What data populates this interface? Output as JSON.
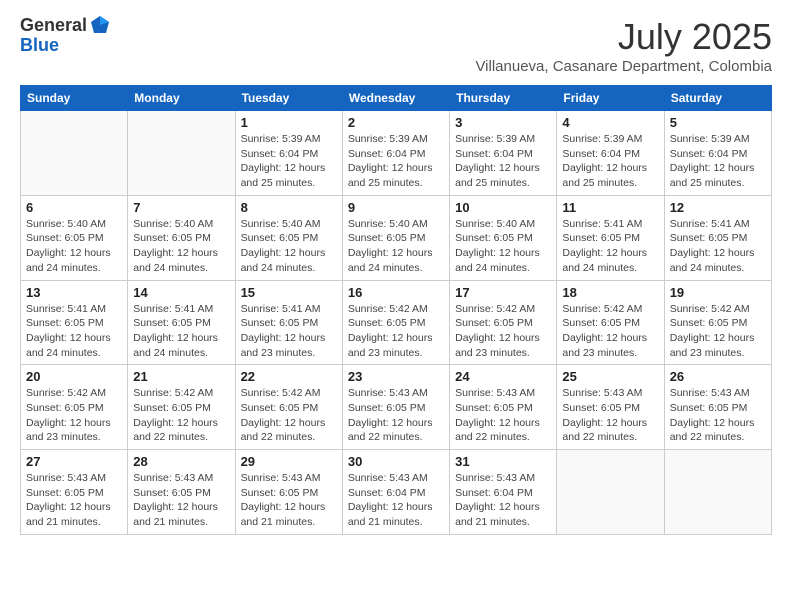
{
  "logo": {
    "general": "General",
    "blue": "Blue"
  },
  "header": {
    "month": "July 2025",
    "location": "Villanueva, Casanare Department, Colombia"
  },
  "weekdays": [
    "Sunday",
    "Monday",
    "Tuesday",
    "Wednesday",
    "Thursday",
    "Friday",
    "Saturday"
  ],
  "weeks": [
    [
      {
        "day": "",
        "detail": ""
      },
      {
        "day": "",
        "detail": ""
      },
      {
        "day": "1",
        "detail": "Sunrise: 5:39 AM\nSunset: 6:04 PM\nDaylight: 12 hours and 25 minutes."
      },
      {
        "day": "2",
        "detail": "Sunrise: 5:39 AM\nSunset: 6:04 PM\nDaylight: 12 hours and 25 minutes."
      },
      {
        "day": "3",
        "detail": "Sunrise: 5:39 AM\nSunset: 6:04 PM\nDaylight: 12 hours and 25 minutes."
      },
      {
        "day": "4",
        "detail": "Sunrise: 5:39 AM\nSunset: 6:04 PM\nDaylight: 12 hours and 25 minutes."
      },
      {
        "day": "5",
        "detail": "Sunrise: 5:39 AM\nSunset: 6:04 PM\nDaylight: 12 hours and 25 minutes."
      }
    ],
    [
      {
        "day": "6",
        "detail": "Sunrise: 5:40 AM\nSunset: 6:05 PM\nDaylight: 12 hours and 24 minutes."
      },
      {
        "day": "7",
        "detail": "Sunrise: 5:40 AM\nSunset: 6:05 PM\nDaylight: 12 hours and 24 minutes."
      },
      {
        "day": "8",
        "detail": "Sunrise: 5:40 AM\nSunset: 6:05 PM\nDaylight: 12 hours and 24 minutes."
      },
      {
        "day": "9",
        "detail": "Sunrise: 5:40 AM\nSunset: 6:05 PM\nDaylight: 12 hours and 24 minutes."
      },
      {
        "day": "10",
        "detail": "Sunrise: 5:40 AM\nSunset: 6:05 PM\nDaylight: 12 hours and 24 minutes."
      },
      {
        "day": "11",
        "detail": "Sunrise: 5:41 AM\nSunset: 6:05 PM\nDaylight: 12 hours and 24 minutes."
      },
      {
        "day": "12",
        "detail": "Sunrise: 5:41 AM\nSunset: 6:05 PM\nDaylight: 12 hours and 24 minutes."
      }
    ],
    [
      {
        "day": "13",
        "detail": "Sunrise: 5:41 AM\nSunset: 6:05 PM\nDaylight: 12 hours and 24 minutes."
      },
      {
        "day": "14",
        "detail": "Sunrise: 5:41 AM\nSunset: 6:05 PM\nDaylight: 12 hours and 24 minutes."
      },
      {
        "day": "15",
        "detail": "Sunrise: 5:41 AM\nSunset: 6:05 PM\nDaylight: 12 hours and 23 minutes."
      },
      {
        "day": "16",
        "detail": "Sunrise: 5:42 AM\nSunset: 6:05 PM\nDaylight: 12 hours and 23 minutes."
      },
      {
        "day": "17",
        "detail": "Sunrise: 5:42 AM\nSunset: 6:05 PM\nDaylight: 12 hours and 23 minutes."
      },
      {
        "day": "18",
        "detail": "Sunrise: 5:42 AM\nSunset: 6:05 PM\nDaylight: 12 hours and 23 minutes."
      },
      {
        "day": "19",
        "detail": "Sunrise: 5:42 AM\nSunset: 6:05 PM\nDaylight: 12 hours and 23 minutes."
      }
    ],
    [
      {
        "day": "20",
        "detail": "Sunrise: 5:42 AM\nSunset: 6:05 PM\nDaylight: 12 hours and 23 minutes."
      },
      {
        "day": "21",
        "detail": "Sunrise: 5:42 AM\nSunset: 6:05 PM\nDaylight: 12 hours and 22 minutes."
      },
      {
        "day": "22",
        "detail": "Sunrise: 5:42 AM\nSunset: 6:05 PM\nDaylight: 12 hours and 22 minutes."
      },
      {
        "day": "23",
        "detail": "Sunrise: 5:43 AM\nSunset: 6:05 PM\nDaylight: 12 hours and 22 minutes."
      },
      {
        "day": "24",
        "detail": "Sunrise: 5:43 AM\nSunset: 6:05 PM\nDaylight: 12 hours and 22 minutes."
      },
      {
        "day": "25",
        "detail": "Sunrise: 5:43 AM\nSunset: 6:05 PM\nDaylight: 12 hours and 22 minutes."
      },
      {
        "day": "26",
        "detail": "Sunrise: 5:43 AM\nSunset: 6:05 PM\nDaylight: 12 hours and 22 minutes."
      }
    ],
    [
      {
        "day": "27",
        "detail": "Sunrise: 5:43 AM\nSunset: 6:05 PM\nDaylight: 12 hours and 21 minutes."
      },
      {
        "day": "28",
        "detail": "Sunrise: 5:43 AM\nSunset: 6:05 PM\nDaylight: 12 hours and 21 minutes."
      },
      {
        "day": "29",
        "detail": "Sunrise: 5:43 AM\nSunset: 6:05 PM\nDaylight: 12 hours and 21 minutes."
      },
      {
        "day": "30",
        "detail": "Sunrise: 5:43 AM\nSunset: 6:04 PM\nDaylight: 12 hours and 21 minutes."
      },
      {
        "day": "31",
        "detail": "Sunrise: 5:43 AM\nSunset: 6:04 PM\nDaylight: 12 hours and 21 minutes."
      },
      {
        "day": "",
        "detail": ""
      },
      {
        "day": "",
        "detail": ""
      }
    ]
  ]
}
